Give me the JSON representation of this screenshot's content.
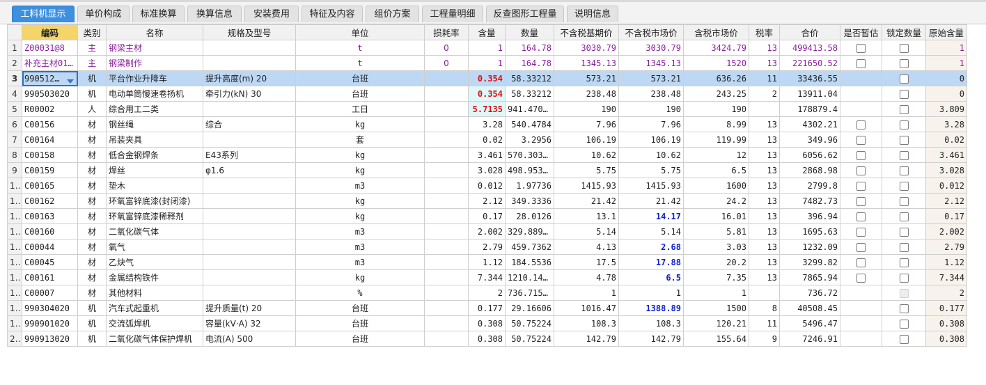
{
  "tabs": [
    {
      "label": "工料机显示",
      "active": true
    },
    {
      "label": "单价构成"
    },
    {
      "label": "标准换算"
    },
    {
      "label": "换算信息"
    },
    {
      "label": "安装费用"
    },
    {
      "label": "特征及内容"
    },
    {
      "label": "组价方案"
    },
    {
      "label": "工程量明细"
    },
    {
      "label": "反查图形工程量"
    },
    {
      "label": "说明信息"
    }
  ],
  "columns": [
    "",
    "编码",
    "类别",
    "名称",
    "规格及型号",
    "单位",
    "损耗率",
    "含量",
    "数量",
    "不含税基期价",
    "不含税市场价",
    "含税市场价",
    "税率",
    "合价",
    "是否暂估",
    "锁定数量",
    "原始含量"
  ],
  "rows": [
    {
      "no": "1",
      "code": "Z00031@8",
      "type": "主",
      "name": "钢梁主材",
      "spec": "",
      "unit": "t",
      "loss": "0",
      "qty": "1",
      "amount": "164.78",
      "base": "3030.79",
      "market": "3030.79",
      "taxed": "3424.79",
      "rate": "13",
      "total": "499413.58",
      "est": true,
      "lock": true,
      "orig": "1"
    },
    {
      "no": "2",
      "code": "补充主材01…",
      "type": "主",
      "name": "钢梁制作",
      "spec": "",
      "unit": "t",
      "loss": "0",
      "qty": "1",
      "amount": "164.78",
      "base": "1345.13",
      "market": "1345.13",
      "taxed": "1520",
      "rate": "13",
      "total": "221650.52",
      "est": true,
      "lock": true,
      "orig": "1"
    },
    {
      "no": "3",
      "code": "990512…",
      "type": "机",
      "name": "平台作业升降车",
      "spec": "提升高度(m) 20",
      "unit": "台班",
      "loss": "",
      "qty": "0.354",
      "amount": "58.33212",
      "base": "573.21",
      "market": "573.21",
      "taxed": "636.26",
      "rate": "11",
      "total": "33436.55",
      "est": false,
      "lock": true,
      "orig": "0"
    },
    {
      "no": "4",
      "code": "990503020",
      "type": "机",
      "name": "电动单筒慢速卷扬机",
      "spec": "牵引力(kN) 30",
      "unit": "台班",
      "loss": "",
      "qty": "0.354",
      "amount": "58.33212",
      "base": "238.48",
      "market": "238.48",
      "taxed": "243.25",
      "rate": "2",
      "total": "13911.04",
      "est": false,
      "lock": true,
      "orig": "0"
    },
    {
      "no": "5",
      "code": "R00002",
      "type": "人",
      "name": "综合用工二类",
      "spec": "",
      "unit": "工日",
      "loss": "",
      "qty": "5.7135",
      "amount": "941.47053",
      "base": "190",
      "market": "190",
      "taxed": "190",
      "rate": "",
      "total": "178879.4",
      "est": false,
      "lock": true,
      "orig": "3.809"
    },
    {
      "no": "6",
      "code": "C00156",
      "type": "材",
      "name": "钢丝绳",
      "spec": "综合",
      "unit": "kg",
      "loss": "",
      "qty": "3.28",
      "amount": "540.4784",
      "base": "7.96",
      "market": "7.96",
      "taxed": "8.99",
      "rate": "13",
      "total": "4302.21",
      "est": true,
      "lock": true,
      "orig": "3.28"
    },
    {
      "no": "7",
      "code": "C00164",
      "type": "材",
      "name": "吊装夹具",
      "spec": "",
      "unit": "套",
      "loss": "",
      "qty": "0.02",
      "amount": "3.2956",
      "base": "106.19",
      "market": "106.19",
      "taxed": "119.99",
      "rate": "13",
      "total": "349.96",
      "est": true,
      "lock": true,
      "orig": "0.02"
    },
    {
      "no": "8",
      "code": "C00158",
      "type": "材",
      "name": "低合金钢焊条",
      "spec": "E43系列",
      "unit": "kg",
      "loss": "",
      "qty": "3.461",
      "amount": "570.30358",
      "base": "10.62",
      "market": "10.62",
      "taxed": "12",
      "rate": "13",
      "total": "6056.62",
      "est": true,
      "lock": true,
      "orig": "3.461"
    },
    {
      "no": "9",
      "code": "C00159",
      "type": "材",
      "name": "焊丝",
      "spec": "φ1.6",
      "unit": "kg",
      "loss": "",
      "qty": "3.028",
      "amount": "498.95384",
      "base": "5.75",
      "market": "5.75",
      "taxed": "6.5",
      "rate": "13",
      "total": "2868.98",
      "est": true,
      "lock": true,
      "orig": "3.028"
    },
    {
      "no": "10",
      "code": "C00165",
      "type": "材",
      "name": "垫木",
      "spec": "",
      "unit": "m3",
      "loss": "",
      "qty": "0.012",
      "amount": "1.97736",
      "base": "1415.93",
      "market": "1415.93",
      "taxed": "1600",
      "rate": "13",
      "total": "2799.8",
      "est": true,
      "lock": true,
      "orig": "0.012"
    },
    {
      "no": "11",
      "code": "C00162",
      "type": "材",
      "name": "环氧富锌底漆(封闭漆)",
      "spec": "",
      "unit": "kg",
      "loss": "",
      "qty": "2.12",
      "amount": "349.3336",
      "base": "21.42",
      "market": "21.42",
      "taxed": "24.2",
      "rate": "13",
      "total": "7482.73",
      "est": true,
      "lock": true,
      "orig": "2.12"
    },
    {
      "no": "12",
      "code": "C00163",
      "type": "材",
      "name": "环氧富锌底漆稀释剂",
      "spec": "",
      "unit": "kg",
      "loss": "",
      "qty": "0.17",
      "amount": "28.0126",
      "base": "13.1",
      "market": "14.17",
      "taxed": "16.01",
      "rate": "13",
      "total": "396.94",
      "est": true,
      "lock": true,
      "orig": "0.17",
      "market_changed": true
    },
    {
      "no": "13",
      "code": "C00160",
      "type": "材",
      "name": "二氧化碳气体",
      "spec": "",
      "unit": "m3",
      "loss": "",
      "qty": "2.002",
      "amount": "329.88956",
      "base": "5.14",
      "market": "5.14",
      "taxed": "5.81",
      "rate": "13",
      "total": "1695.63",
      "est": true,
      "lock": true,
      "orig": "2.002"
    },
    {
      "no": "14",
      "code": "C00044",
      "type": "材",
      "name": "氧气",
      "spec": "",
      "unit": "m3",
      "loss": "",
      "qty": "2.79",
      "amount": "459.7362",
      "base": "4.13",
      "market": "2.68",
      "taxed": "3.03",
      "rate": "13",
      "total": "1232.09",
      "est": true,
      "lock": true,
      "orig": "2.79",
      "market_changed": true
    },
    {
      "no": "15",
      "code": "C00045",
      "type": "材",
      "name": "乙炔气",
      "spec": "",
      "unit": "m3",
      "loss": "",
      "qty": "1.12",
      "amount": "184.5536",
      "base": "17.5",
      "market": "17.88",
      "taxed": "20.2",
      "rate": "13",
      "total": "3299.82",
      "est": true,
      "lock": true,
      "orig": "1.12",
      "market_changed": true
    },
    {
      "no": "16",
      "code": "C00161",
      "type": "材",
      "name": "金属结构铁件",
      "spec": "",
      "unit": "kg",
      "loss": "",
      "qty": "7.344",
      "amount": "1210.14432",
      "base": "4.78",
      "market": "6.5",
      "taxed": "7.35",
      "rate": "13",
      "total": "7865.94",
      "est": true,
      "lock": true,
      "orig": "7.344",
      "market_changed": true
    },
    {
      "no": "17",
      "code": "C00007",
      "type": "材",
      "name": "其他材料",
      "spec": "",
      "unit": "%",
      "loss": "",
      "qty": "2",
      "amount": "736.71582",
      "base": "1",
      "market": "1",
      "taxed": "1",
      "rate": "",
      "total": "736.72",
      "est": false,
      "lock": "disabled",
      "orig": "2"
    },
    {
      "no": "18",
      "code": "990304020",
      "type": "机",
      "name": "汽车式起重机",
      "spec": "提升质量(t) 20",
      "unit": "台班",
      "loss": "",
      "qty": "0.177",
      "amount": "29.16606",
      "base": "1016.47",
      "market": "1388.89",
      "taxed": "1500",
      "rate": "8",
      "total": "40508.45",
      "est": false,
      "lock": true,
      "orig": "0.177",
      "market_changed": true
    },
    {
      "no": "19",
      "code": "990901020",
      "type": "机",
      "name": "交流弧焊机",
      "spec": "容量(kV·A) 32",
      "unit": "台班",
      "loss": "",
      "qty": "0.308",
      "amount": "50.75224",
      "base": "108.3",
      "market": "108.3",
      "taxed": "120.21",
      "rate": "11",
      "total": "5496.47",
      "est": false,
      "lock": true,
      "orig": "0.308"
    },
    {
      "no": "20",
      "code": "990913020",
      "type": "机",
      "name": "二氧化碳气体保护焊机",
      "spec": "电流(A) 500",
      "unit": "台班",
      "loss": "",
      "qty": "0.308",
      "amount": "50.75224",
      "base": "142.79",
      "market": "142.79",
      "taxed": "155.64",
      "rate": "9",
      "total": "7246.91",
      "est": false,
      "lock": true,
      "orig": "0.308"
    }
  ],
  "colors": {
    "accent": "#3d8fe0",
    "selected_row": "#bdd8f5",
    "qty_red": "#e01010",
    "price_blue": "#1020d0",
    "main_material": "#8a1f9c",
    "code_header": "#f4d56a"
  },
  "icons": {
    "code_dropdown": "chevron-down-icon",
    "checkbox": "checkbox-icon"
  }
}
